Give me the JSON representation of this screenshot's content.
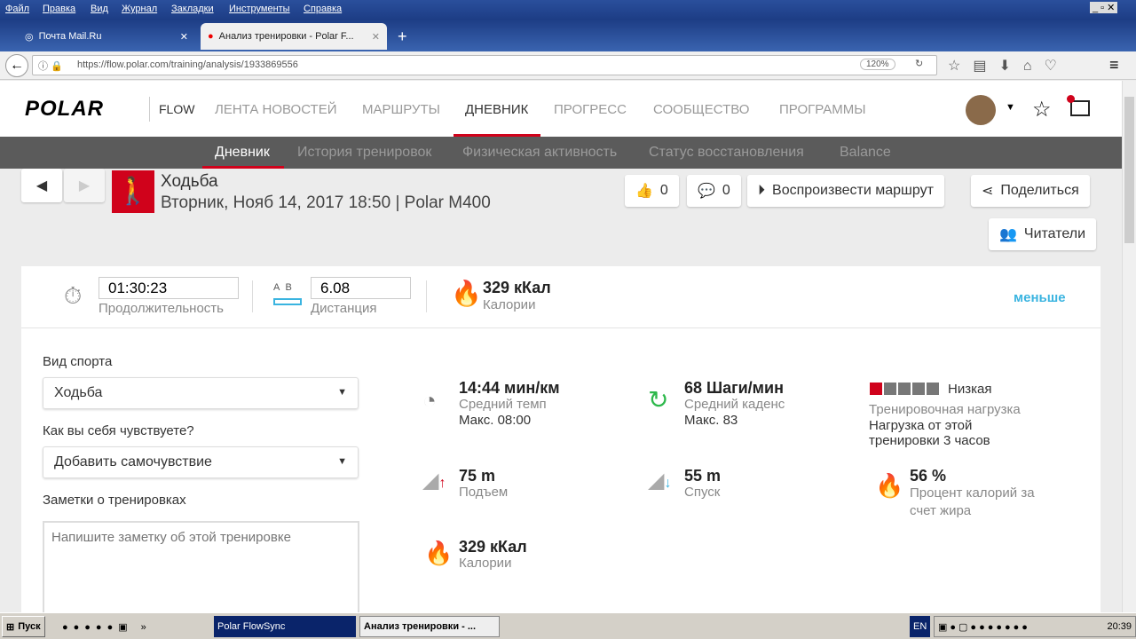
{
  "browser": {
    "menu": [
      "Файл",
      "Правка",
      "Вид",
      "Журнал",
      "Закладки",
      "Инструменты",
      "Справка"
    ],
    "tabs": [
      {
        "title": "Почта Mail.Ru"
      },
      {
        "title": "Анализ тренировки - Polar F..."
      }
    ],
    "url": "https://flow.polar.com/training/analysis/1933869556",
    "zoom": "120%"
  },
  "header": {
    "logo": "POLAR",
    "flow": "FLOW",
    "nav": [
      "ЛЕНТА НОВОСТЕЙ",
      "МАРШРУТЫ",
      "ДНЕВНИК",
      "ПРОГРЕСС",
      "СООБЩЕСТВО",
      "ПРОГРАММЫ"
    ],
    "active": "ДНЕВНИК"
  },
  "subnav": [
    "Дневник",
    "История тренировок",
    "Физическая активность",
    "Статус восстановления",
    "Balance"
  ],
  "training": {
    "sport": "Ходьба",
    "subtitle": "Вторник, Нояб 14, 2017 18:50 | Polar M400",
    "likes": "0",
    "comments": "0",
    "replay": "Воспроизвести маршрут",
    "share": "Поделиться",
    "readers": "Читатели"
  },
  "summary": {
    "duration": "01:30:23",
    "duration_label": "Продолжительность",
    "ab_a": "A",
    "ab_b": "B",
    "distance": "6.08",
    "distance_label": "Дистанция",
    "calories": "329 кКал",
    "calories_label": "Калории",
    "less": "меньше"
  },
  "form": {
    "sport_label": "Вид спорта",
    "sport_value": "Ходьба",
    "feel_label": "Как вы себя чувствуете?",
    "feel_value": "Добавить самочувствие",
    "notes_label": "Заметки о тренировках",
    "notes_placeholder": "Напишите заметку об этой тренировке"
  },
  "stats": {
    "pace": "14:44 мин/км",
    "pace_label": "Средний темп",
    "pace_max": "Макс. 08:00",
    "cadence": "68 Шаги/мин",
    "cadence_label": "Средний каденс",
    "cadence_max": "Макс. 83",
    "load": "Низкая",
    "load_label": "Тренировочная нагрузка",
    "load_desc": "Нагрузка от этой тренировки 3 часов",
    "load_level": 1,
    "load_of": 5,
    "ascent": "75 m",
    "ascent_label": "Подъем",
    "descent": "55 m",
    "descent_label": "Спуск",
    "fat": "56 %",
    "fat_label": "Процент калорий за счет жира",
    "kcal": "329 кКал",
    "kcal_label": "Калории"
  },
  "taskbar": {
    "start": "Пуск",
    "items": [
      "Polar FlowSync",
      "Анализ тренировки - ..."
    ],
    "lang": "EN",
    "time": "20:39"
  },
  "colors": {
    "accent": "#d0021b",
    "link": "#3ab4e0",
    "flame": "#f5a623"
  }
}
